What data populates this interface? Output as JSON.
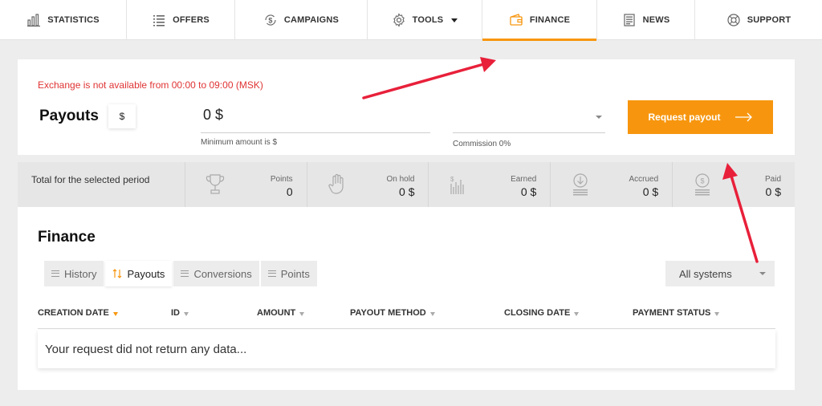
{
  "nav": {
    "items": [
      {
        "label": "STATISTICS",
        "icon": "chart-icon"
      },
      {
        "label": "OFFERS",
        "icon": "list-icon"
      },
      {
        "label": "CAMPAIGNS",
        "icon": "dollar-cycle-icon"
      },
      {
        "label": "TOOLS",
        "icon": "gear-icon"
      },
      {
        "label": "FINANCE",
        "icon": "wallet-icon"
      },
      {
        "label": "NEWS",
        "icon": "newspaper-icon"
      },
      {
        "label": "SUPPORT",
        "icon": "lifebuoy-icon"
      }
    ],
    "active": "FINANCE"
  },
  "payout": {
    "exchange_note": "Exchange is not available from 00:00 to 09:00 (MSK)",
    "title": "Payouts",
    "currency": "$",
    "amount_value": "0 $",
    "min_amount": "Minimum amount is $",
    "commission": "Commission 0%",
    "request_label": "Request payout"
  },
  "stats": {
    "label": "Total for the selected period",
    "items": [
      {
        "name": "Points",
        "value": "0",
        "icon": "trophy-icon"
      },
      {
        "name": "On hold",
        "value": "0 $",
        "icon": "hand-icon"
      },
      {
        "name": "Earned",
        "value": "0 $",
        "icon": "bar-chart-dollar-icon"
      },
      {
        "name": "Accrued",
        "value": "0 $",
        "icon": "download-coin-icon"
      },
      {
        "name": "Paid",
        "value": "0 $",
        "icon": "coin-stack-icon"
      }
    ]
  },
  "finance": {
    "title": "Finance",
    "tabs": [
      {
        "label": "History"
      },
      {
        "label": "Payouts"
      },
      {
        "label": "Conversions"
      },
      {
        "label": "Points"
      }
    ],
    "active_tab": "Payouts",
    "systems_filter": "All systems",
    "columns": [
      {
        "label": "CREATION DATE"
      },
      {
        "label": "ID"
      },
      {
        "label": "AMOUNT"
      },
      {
        "label": "PAYOUT METHOD"
      },
      {
        "label": "CLOSING DATE"
      },
      {
        "label": "PAYMENT STATUS"
      }
    ],
    "empty_message": "Your request did not return any data..."
  },
  "colors": {
    "accent": "#f7960e",
    "warning_text": "#e03333",
    "annotation_arrow": "#e8203a"
  }
}
